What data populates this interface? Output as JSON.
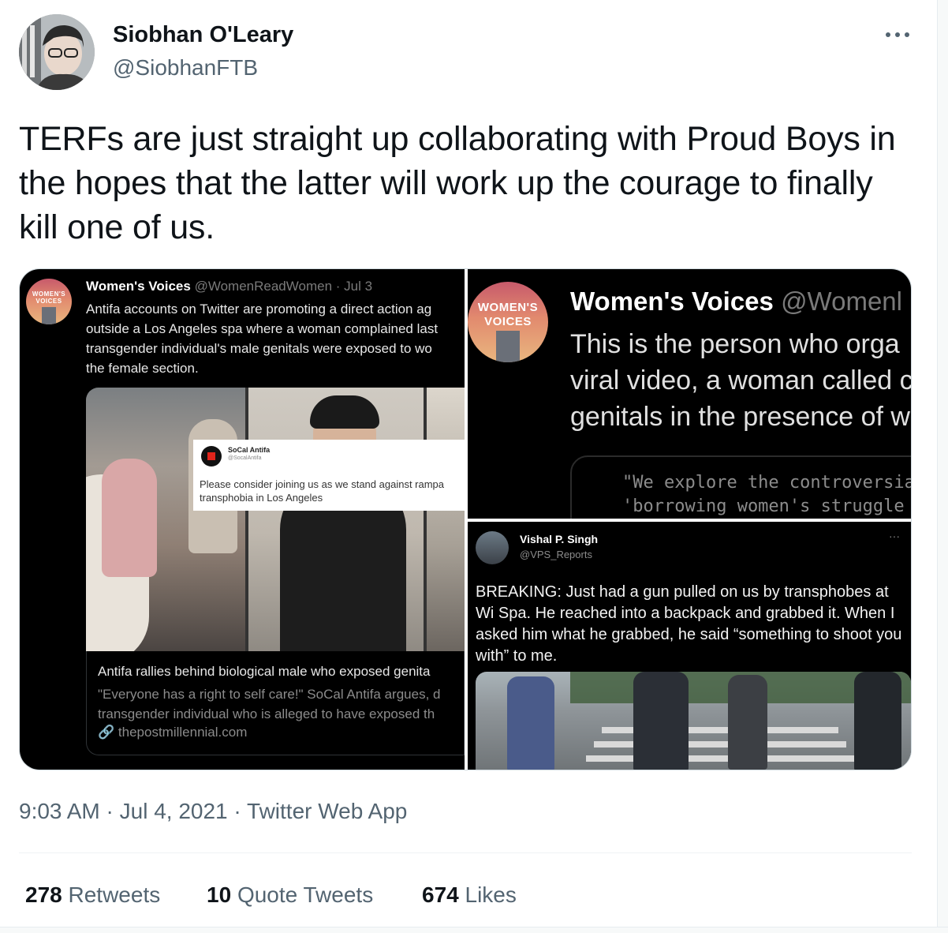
{
  "author": {
    "name": "Siobhan O'Leary",
    "handle": "@SiobhanFTB"
  },
  "tweet": {
    "text": "TERFs are just straight up collaborating with Proud Boys in the hopes that the latter will work up the courage to finally kill one of us."
  },
  "media": {
    "panel1": {
      "avatar_line1": "WOMEN'S",
      "avatar_line2": "VOICES",
      "name": "Women's Voices",
      "handle_date": "@WomenReadWomen · Jul 3",
      "body": [
        "Antifa accounts on Twitter are promoting a direct action ag",
        "outside a Los Angeles spa where a woman complained last",
        "transgender individual's male genitals were exposed to wo",
        "the female section."
      ],
      "inset": {
        "name": "SoCal Antifa",
        "handle": "@SocalAntifa",
        "text": [
          "Please consider joining us as we stand against rampa",
          "transphobia in Los Angeles"
        ]
      },
      "card": {
        "title": "Antifa rallies behind biological male who exposed genita",
        "desc": [
          "\"Everyone has a right to self care!\" SoCal Antifa argues, d",
          "transgender individual who is alleged to have exposed th"
        ],
        "link": "thepostmillennial.com"
      }
    },
    "panel2": {
      "avatar_line1": "WOMEN'S",
      "avatar_line2": "VOICES",
      "name": "Women's Voices",
      "handle": "@Womenl",
      "body": [
        "This is the person who orga",
        "viral video, a woman called c",
        "genitals in the presence of w"
      ],
      "quote": [
        "\"We explore the controversia",
        "'borrowing women's struggle"
      ]
    },
    "panel3": {
      "name": "Vishal P. Singh",
      "handle": "@VPS_Reports",
      "more": "···",
      "body": "BREAKING: Just had a gun pulled on us by transphobes at Wi Spa. He reached into a backpack and grabbed it. When I asked him what he grabbed, he said “something to shoot you with” to me."
    }
  },
  "meta": {
    "time": "9:03 AM",
    "date": "Jul 4, 2021",
    "source": "Twitter Web App",
    "separator": "·"
  },
  "stats": {
    "retweets_count": "278",
    "retweets_label": "Retweets",
    "quotes_count": "10",
    "quotes_label": "Quote Tweets",
    "likes_count": "674",
    "likes_label": "Likes"
  },
  "colors": {
    "text": "#0f1419",
    "secondary": "#536471",
    "border": "#cfd9de"
  }
}
